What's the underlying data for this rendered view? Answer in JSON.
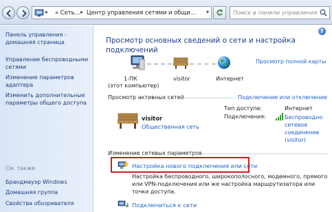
{
  "address": {
    "segment1": "« Сеть...",
    "segment2": "Центр управления сетями и общи..."
  },
  "search": {
    "placeholder": "Поиск в панели управления"
  },
  "sidebar": {
    "items": [
      {
        "label": "Панель управления - домашняя страница"
      },
      {
        "label": "Управление беспроводными сетями"
      },
      {
        "label": "Изменение параметров адаптера"
      },
      {
        "label": "Изменить дополнительные параметры общего доступа"
      }
    ],
    "see_also": {
      "heading": "См. также",
      "items": [
        {
          "label": "Брандмауэр Windows"
        },
        {
          "label": "Домашняя группа"
        },
        {
          "label": "Свойства обозревателя"
        }
      ]
    }
  },
  "main": {
    "title": "Просмотр основных сведений о сети и настройка подключений",
    "full_map_link": "Просмотр полной карты",
    "map_nodes": [
      {
        "name": "1-ПК",
        "subtitle": "(этот компьютер)"
      },
      {
        "name": "visitor"
      },
      {
        "name": "Интернет"
      }
    ],
    "active_networks": {
      "heading": "Просмотр активных сетей",
      "connect_link": "Подключение или отключение",
      "network_name": "visitor",
      "network_type": "Общественная сеть",
      "access_type_label": "Тип доступа:",
      "access_type_value": "Интернет",
      "connections_label": "Подключения:",
      "connections_value": "Беспроводно сетевое соединение (visitor)"
    },
    "change_settings": {
      "heading": "Изменение сетевых параметров",
      "new_connection_link": "Настройка нового подключения или сети",
      "new_connection_desc": "Настройка беспроводного, широкополосного, модемного, прямого или VPN-подключения или же настройка маршрутизатора или точки доступа.",
      "connect_to_network_link": "Подключиться к сети"
    }
  },
  "colors": {
    "link": "#1d5fc6",
    "title": "#1e3e87",
    "highlight": "#d11b1b"
  }
}
